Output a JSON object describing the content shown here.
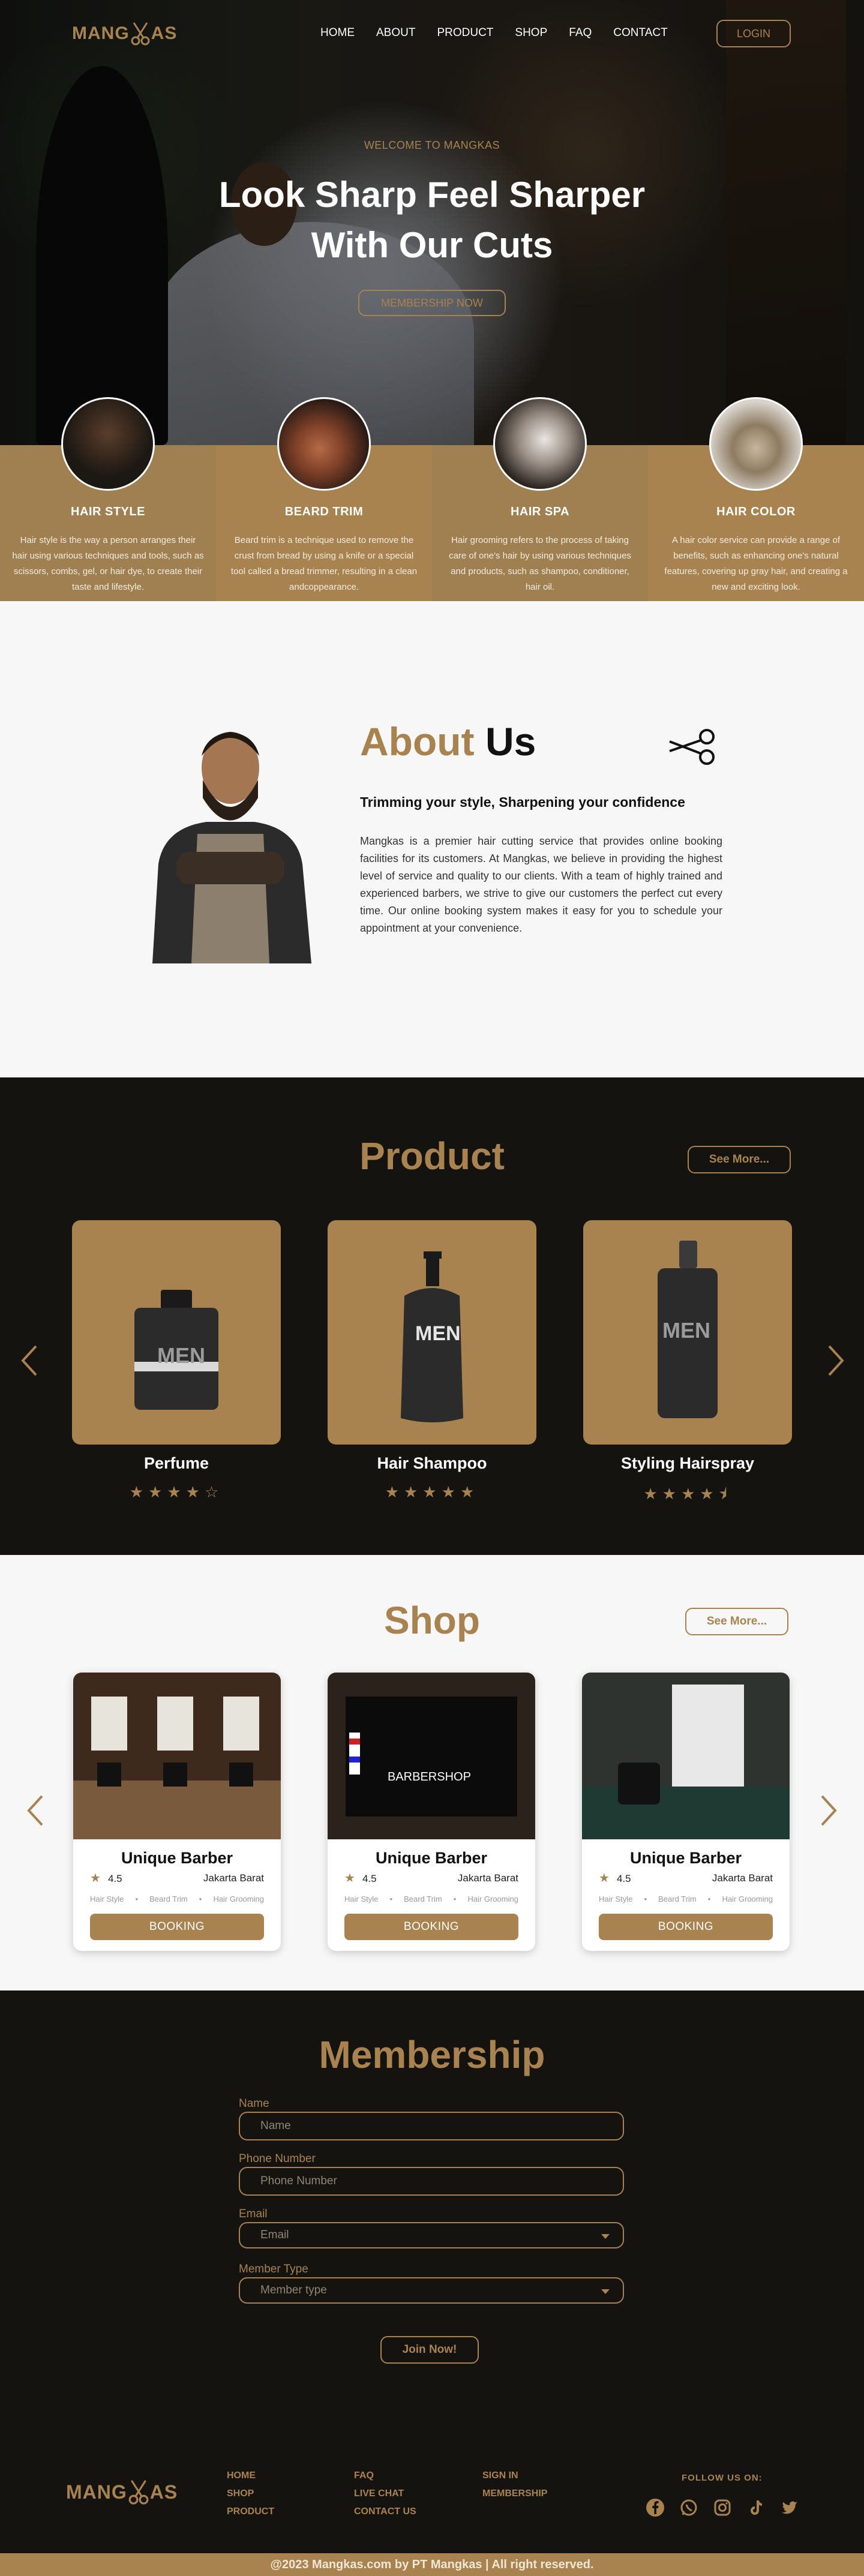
{
  "brand": {
    "logo_left": "MANG",
    "logo_right": "AS",
    "accent": "#a8834f"
  },
  "nav": {
    "links": [
      "HOME",
      "ABOUT",
      "PRODUCT",
      "SHOP",
      "FAQ",
      "CONTACT"
    ],
    "login_label": "LOGIN"
  },
  "hero": {
    "welcome": "WELCOME TO MANGKAS",
    "headline_line1": "Look Sharp Feel Sharper",
    "headline_line2": "With Our Cuts",
    "cta_label": "MEMBERSHIP NOW"
  },
  "services": [
    {
      "title": "HAIR STYLE",
      "desc": "Hair style is the way a person arranges their hair using various techniques and tools, such as scissors, combs, gel, or hair dye, to create their taste and lifestyle."
    },
    {
      "title": "BEARD TRIM",
      "desc": "Beard trim is a technique used to remove the crust from bread by using a knife or a special tool called a bread trimmer, resulting in a clean andcoppearance."
    },
    {
      "title": "HAIR SPA",
      "desc": "Hair grooming refers to the process of taking care of one's hair by using various techniques and products, such as shampoo, conditioner, hair oil."
    },
    {
      "title": "HAIR COLOR",
      "desc": "A hair color service can provide a range of benefits, such as enhancing one's natural features, covering up gray hair, and creating a new and exciting look."
    }
  ],
  "about": {
    "title_gold": "About",
    "title_dark": "Us",
    "subtitle": "Trimming your style, Sharpening your confidence",
    "body": "Mangkas is a premier hair cutting service that provides online booking facilities for its customers. At Mangkas, we believe in providing the highest level of service and quality to our clients. With a team of highly trained and experienced barbers, we strive to give our customers the perfect cut every time. Our online booking system makes it easy for you to schedule your appointment at your convenience."
  },
  "product": {
    "title": "Product",
    "see_more": "See More...",
    "items": [
      {
        "name": "Perfume",
        "rating": 4,
        "label": "MEN"
      },
      {
        "name": "Hair Shampoo",
        "rating": 5,
        "label": "MEN"
      },
      {
        "name": "Styling Hairspray",
        "rating": 4.5,
        "label": "MEN"
      }
    ]
  },
  "shop": {
    "title": "Shop",
    "see_more": "See More...",
    "items": [
      {
        "name": "Unique Barber",
        "rating": "4.5",
        "location": "Jakarta Barat",
        "tags": [
          "Hair Style",
          "Beard Trim",
          "Hair Grooming"
        ],
        "button": "BOOKING"
      },
      {
        "name": "Unique Barber",
        "rating": "4.5",
        "location": "Jakarta Barat",
        "tags": [
          "Hair Style",
          "Beard Trim",
          "Hair Grooming"
        ],
        "button": "BOOKING",
        "sign": "BARBERSHOP"
      },
      {
        "name": "Unique Barber",
        "rating": "4.5",
        "location": "Jakarta Barat",
        "tags": [
          "Hair Style",
          "Beard Trim",
          "Hair Grooming"
        ],
        "button": "BOOKING"
      }
    ]
  },
  "membership": {
    "title": "Membership",
    "fields": [
      {
        "label": "Name",
        "placeholder": "Name",
        "type": "text"
      },
      {
        "label": "Phone Number",
        "placeholder": "Phone Number",
        "type": "text"
      },
      {
        "label": "Email",
        "placeholder": "Email",
        "type": "select"
      },
      {
        "label": "Member Type",
        "placeholder": "Member type",
        "type": "select"
      }
    ],
    "submit": "Join Now!"
  },
  "footer": {
    "col1": [
      "HOME",
      "SHOP",
      "PRODUCT"
    ],
    "col2": [
      "FAQ",
      "LIVE CHAT",
      "CONTACT US"
    ],
    "col3": [
      "SIGN IN",
      "MEMBERSHIP"
    ],
    "follow": "FOLLOW US ON:",
    "socials": [
      "facebook-icon",
      "whatsapp-icon",
      "instagram-icon",
      "tiktok-icon",
      "twitter-icon"
    ],
    "copyright": "@2023 Mangkas.com by PT Mangkas | All right reserved."
  }
}
